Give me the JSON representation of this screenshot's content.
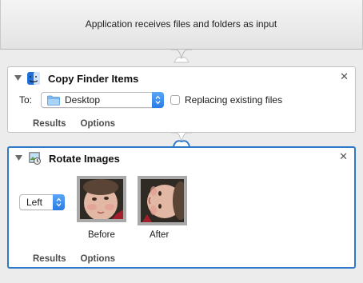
{
  "input_banner": {
    "text": "Application receives files and folders as input"
  },
  "actions": [
    {
      "name": "Copy Finder Items",
      "to_label": "To:",
      "destination": "Desktop",
      "replace_label": "Replacing existing files",
      "replace_checked": false,
      "tabs": [
        "Results",
        "Options"
      ]
    },
    {
      "name": "Rotate Images",
      "direction": "Left",
      "before_label": "Before",
      "after_label": "After",
      "tabs": [
        "Results",
        "Options"
      ]
    }
  ],
  "colors": {
    "selection": "#2f78c8",
    "accent": "#2a7be4"
  }
}
